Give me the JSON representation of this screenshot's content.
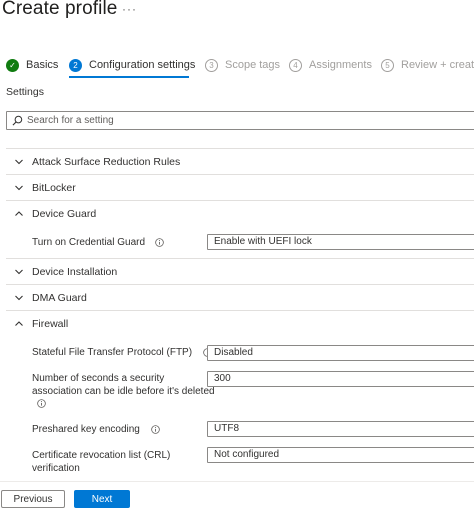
{
  "header": {
    "title": "Create profile",
    "more": "···"
  },
  "steps": [
    {
      "num": "✓",
      "label": "Basics",
      "state": "done"
    },
    {
      "num": "2",
      "label": "Configuration settings",
      "state": "current"
    },
    {
      "num": "3",
      "label": "Scope tags",
      "state": "todo"
    },
    {
      "num": "4",
      "label": "Assignments",
      "state": "todo"
    },
    {
      "num": "5",
      "label": "Review + create",
      "state": "todo"
    }
  ],
  "settings": {
    "label": "Settings",
    "search_placeholder": "Search for a setting",
    "categories": [
      {
        "label": "Attack Surface Reduction Rules",
        "expanded": false
      },
      {
        "label": "BitLocker",
        "expanded": false
      },
      {
        "label": "Device Guard",
        "expanded": true
      },
      {
        "label": "Device Installation",
        "expanded": false
      },
      {
        "label": "DMA Guard",
        "expanded": false
      },
      {
        "label": "Firewall",
        "expanded": true
      }
    ],
    "device_guard": {
      "credential_guard": {
        "label": "Turn on Credential Guard",
        "value": "Enable with UEFI lock"
      }
    },
    "firewall": {
      "ftp": {
        "label": "Stateful File Transfer Protocol (FTP)",
        "value": "Disabled"
      },
      "idle": {
        "label_1": "Number of seconds a security",
        "label_2": "association can be idle before it's deleted",
        "value": "300"
      },
      "preshared": {
        "label": "Preshared key encoding",
        "value": "UTF8"
      },
      "crl": {
        "label_1": "Certificate revocation list (CRL)",
        "label_2": "verification",
        "value": "Not configured"
      }
    }
  },
  "footer": {
    "previous": "Previous",
    "next": "Next"
  },
  "colors": {
    "accent": "#0078d4",
    "success": "#107c10",
    "disabled": "#a19f9d"
  }
}
